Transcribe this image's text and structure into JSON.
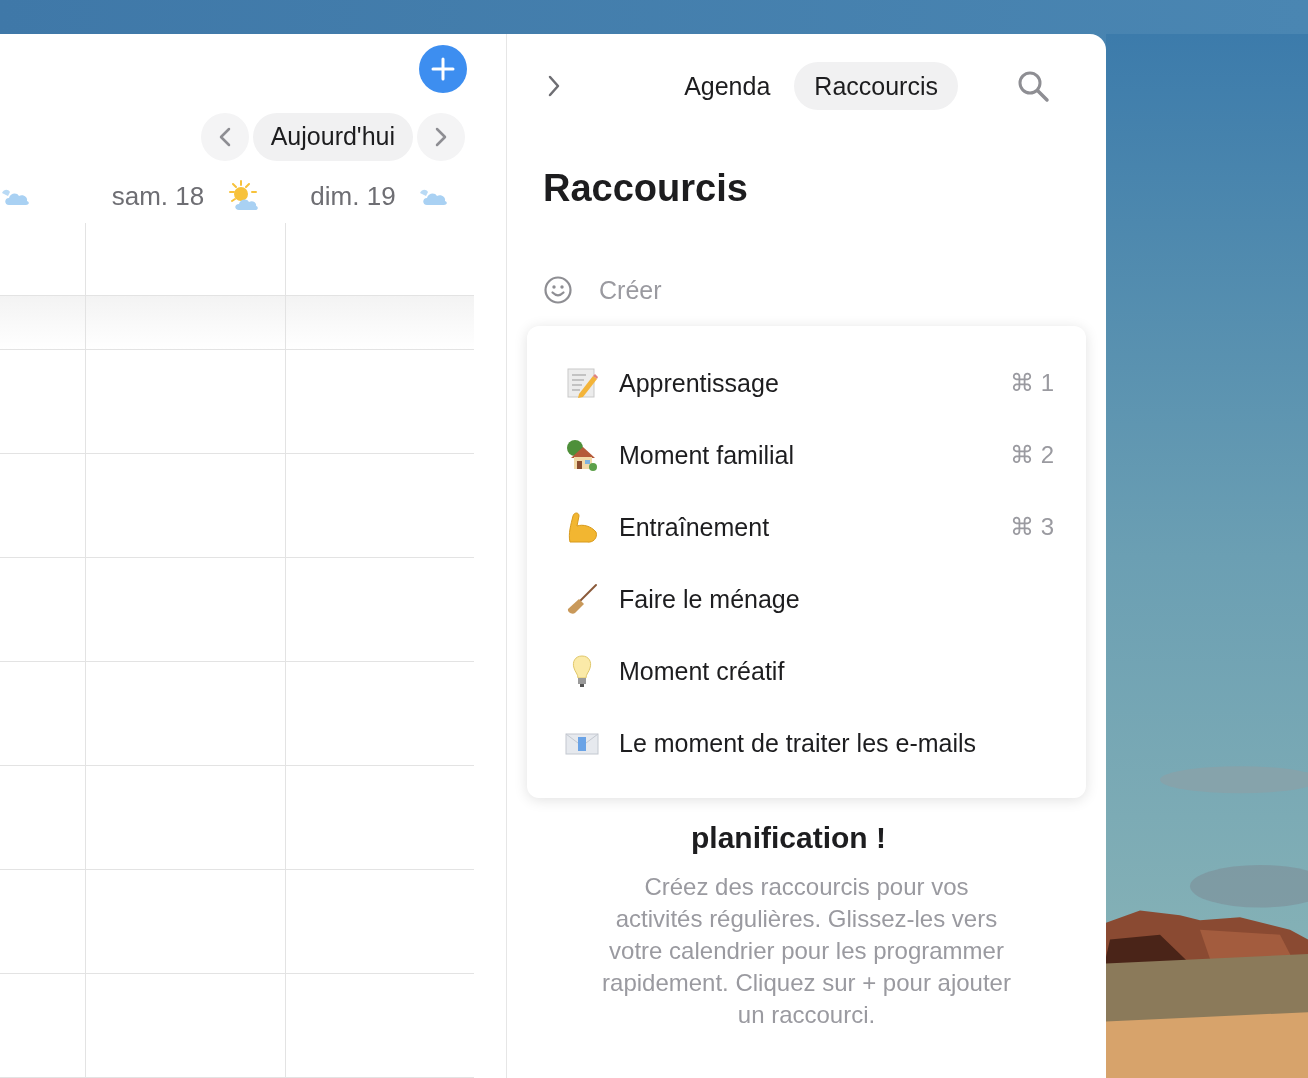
{
  "calendar": {
    "today_button": "Aujourd'hui",
    "days": [
      {
        "kind": "cloud"
      },
      {
        "label": "sam. 18",
        "kind": "sun-cloud"
      },
      {
        "label": "dim. 19",
        "kind": "cloud"
      }
    ]
  },
  "panel": {
    "tabs": [
      {
        "label": "Agenda",
        "selected": false
      },
      {
        "label": "Raccourcis",
        "selected": true
      }
    ],
    "title": "Raccourcis",
    "create": {
      "placeholder": "Créer"
    },
    "shortcuts": [
      {
        "label": "Apprentissage",
        "shortcut": "⌘ 1"
      },
      {
        "label": "Moment familial",
        "shortcut": "⌘ 2"
      },
      {
        "label": "Entraînement",
        "shortcut": "⌘ 3"
      },
      {
        "label": "Faire le ménage"
      },
      {
        "label": "Moment créatif"
      },
      {
        "label": "Le moment de traiter les e-mails"
      }
    ],
    "empty_heading": "planification !",
    "empty_text": "Créez des raccourcis pour vos activités régulières. Glissez-les vers votre calendrier pour les programmer rapidement. Cliquez sur + pour ajouter un raccourci."
  }
}
